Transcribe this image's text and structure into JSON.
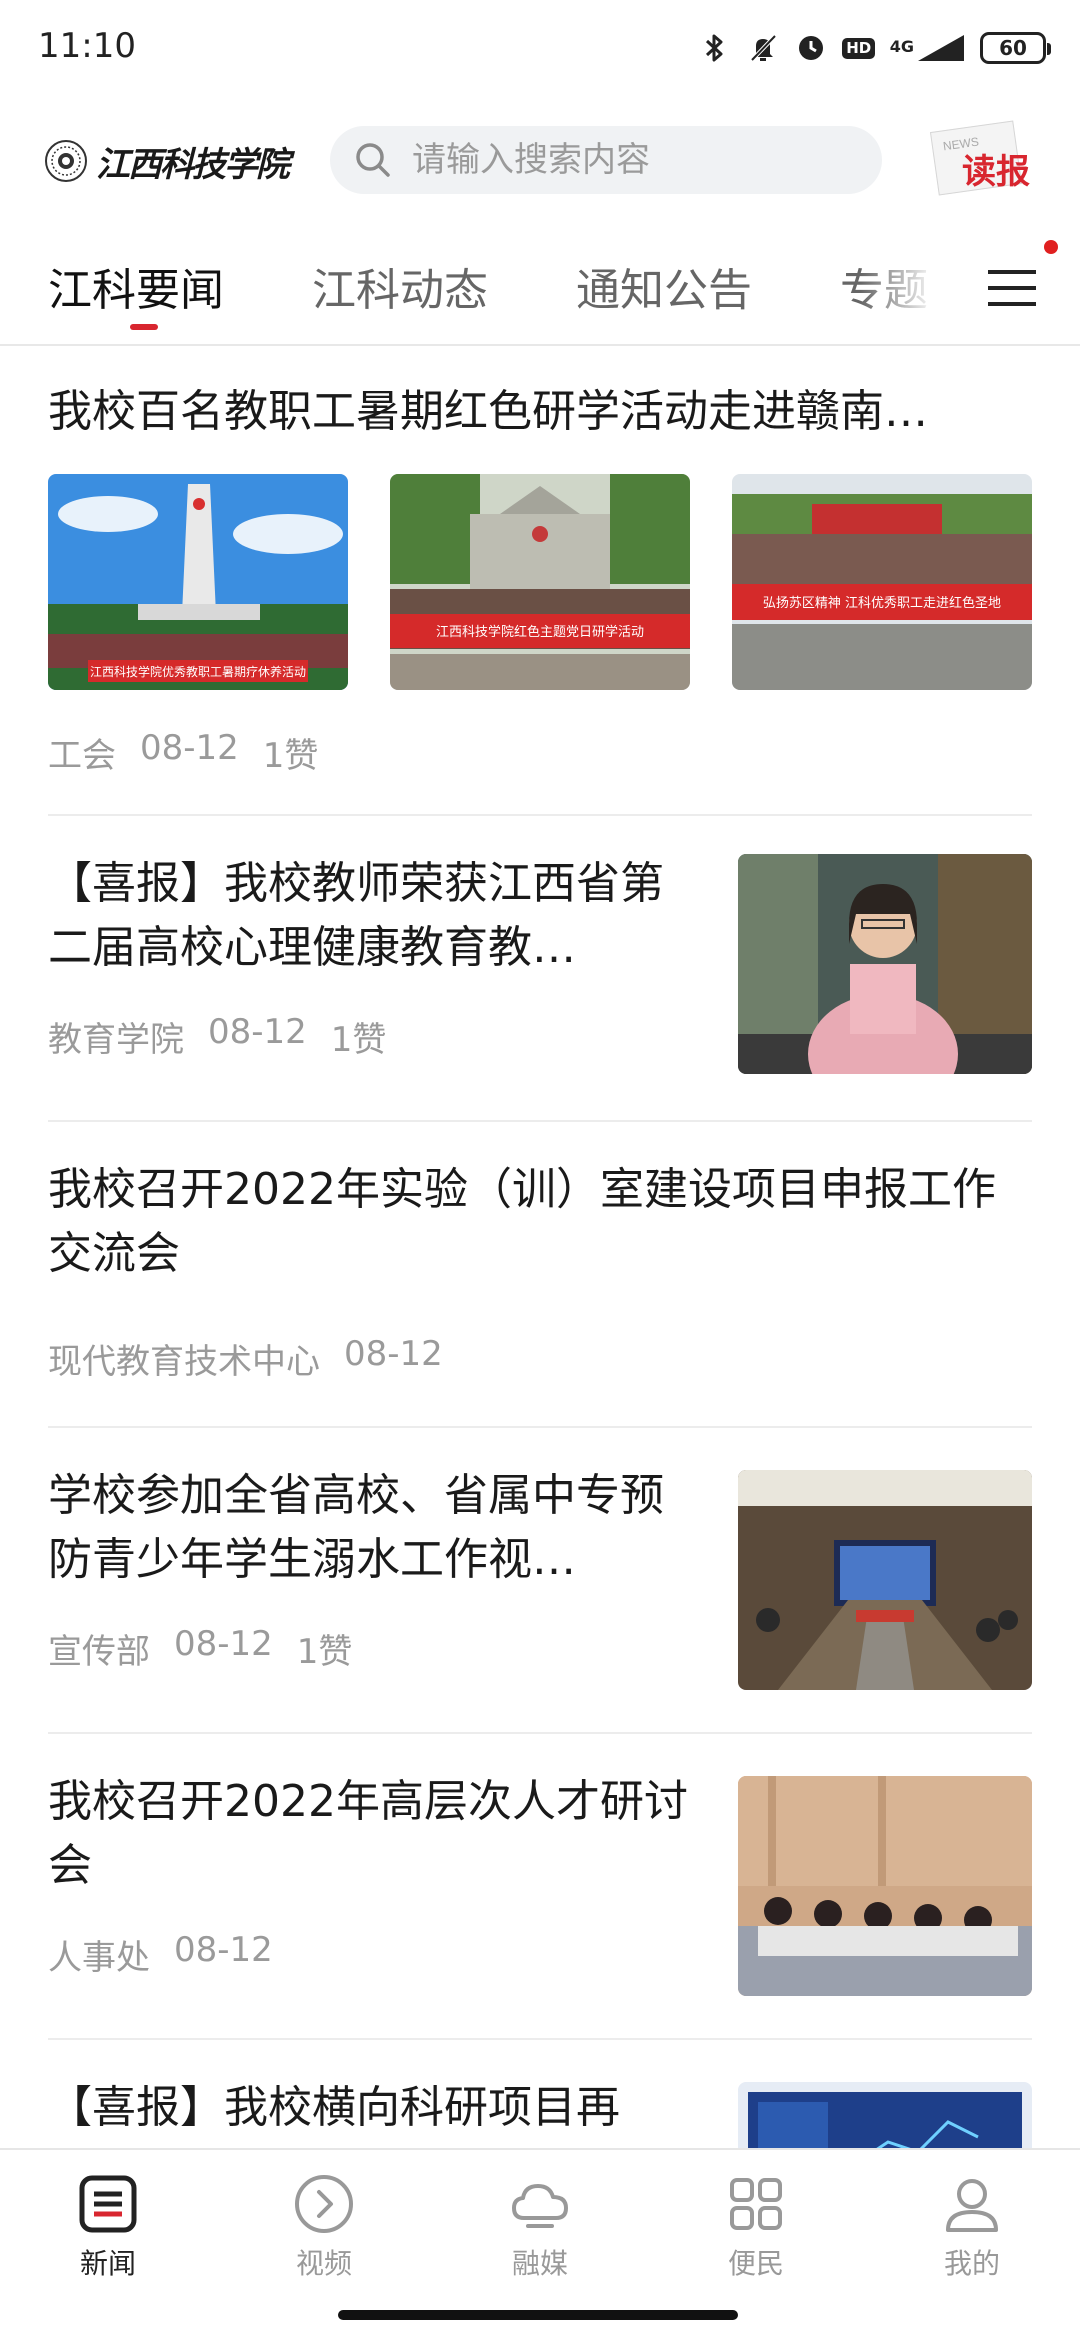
{
  "status_bar": {
    "time": "11:10",
    "network": "4G",
    "battery": "60",
    "hd": "HD",
    "icons": [
      "bluetooth-icon",
      "mute-icon",
      "alarm-icon",
      "hd-icon",
      "signal-icon",
      "battery-icon"
    ]
  },
  "header": {
    "logo_text": "江西科技学院",
    "search_placeholder": "请输入搜索内容",
    "newspaper_label": "读报",
    "newspaper_small": "NEWS"
  },
  "tabs": [
    {
      "label": "江科要闻",
      "active": true
    },
    {
      "label": "江科动态",
      "active": false
    },
    {
      "label": "通知公告",
      "active": false
    },
    {
      "label": "专题",
      "active": false
    }
  ],
  "news": [
    {
      "title": "我校百名教职工暑期红色研学活动走进赣南…",
      "source": "工会",
      "date": "08-12",
      "likes": "1赞",
      "images": [
        {
          "caption": "江西科技学院优秀教职工暑期疗休养活动"
        },
        {
          "caption": "江西科技学院红色主题党日研学活动"
        },
        {
          "caption": "弘扬苏区精神 江科优秀职工走进红色圣地"
        }
      ]
    },
    {
      "title": "【喜报】我校教师荣获江西省第二届高校心理健康教育教…",
      "source": "教育学院",
      "date": "08-12",
      "likes": "1赞"
    },
    {
      "title": "我校召开2022年实验（训）室建设项目申报工作交流会",
      "source": "现代教育技术中心",
      "date": "08-12",
      "likes": ""
    },
    {
      "title": "学校参加全省高校、省属中专预防青少年学生溺水工作视…",
      "source": "宣传部",
      "date": "08-12",
      "likes": "1赞"
    },
    {
      "title": "我校召开2022年高层次人才研讨会",
      "source": "人事处",
      "date": "08-12",
      "likes": ""
    },
    {
      "title": "【喜报】我校横向科研项目再"
    }
  ],
  "bottom_nav": [
    {
      "label": "新闻",
      "icon": "news-icon",
      "active": true
    },
    {
      "label": "视频",
      "icon": "video-icon",
      "active": false
    },
    {
      "label": "融媒",
      "icon": "cloud-icon",
      "active": false
    },
    {
      "label": "便民",
      "icon": "grid-icon",
      "active": false
    },
    {
      "label": "我的",
      "icon": "user-icon",
      "active": false
    }
  ],
  "colors": {
    "accent": "#d8262f",
    "muted": "#9a9a9a",
    "text": "#1a1a1a"
  }
}
